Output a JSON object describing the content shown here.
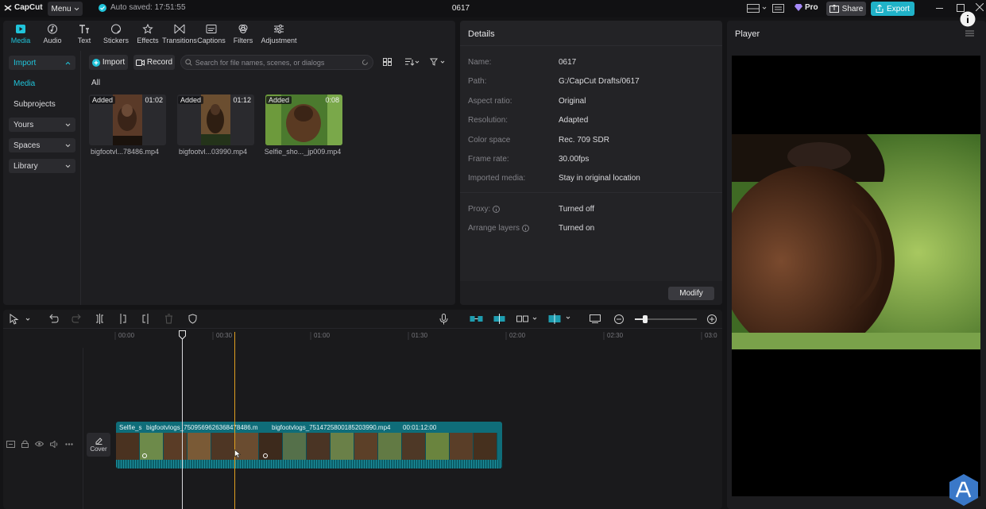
{
  "titlebar": {
    "app_name": "CapCut",
    "menu_label": "Menu",
    "autosave_text": "Auto saved: 17:51:55",
    "project_title": "0617",
    "pro_label": "Pro",
    "share_label": "Share",
    "export_label": "Export"
  },
  "tooltabs": [
    {
      "label": "Media",
      "icon": "media-icon",
      "active": true
    },
    {
      "label": "Audio",
      "icon": "audio-icon"
    },
    {
      "label": "Text",
      "icon": "text-icon"
    },
    {
      "label": "Stickers",
      "icon": "stickers-icon"
    },
    {
      "label": "Effects",
      "icon": "effects-icon"
    },
    {
      "label": "Transitions",
      "icon": "transitions-icon"
    },
    {
      "label": "Captions",
      "icon": "captions-icon"
    },
    {
      "label": "Filters",
      "icon": "filters-icon"
    },
    {
      "label": "Adjustment",
      "icon": "adjustment-icon"
    }
  ],
  "leftnav": {
    "import": "Import",
    "media": "Media",
    "subprojects": "Subprojects",
    "yours": "Yours",
    "spaces": "Spaces",
    "library": "Library"
  },
  "media": {
    "import_button": "Import",
    "record_button": "Record",
    "search_placeholder": "Search for file names, scenes, or dialogs",
    "filter_all": "All",
    "clips": [
      {
        "badge": "Added",
        "duration": "01:02",
        "name": "bigfootvl...78486.mp4"
      },
      {
        "badge": "Added",
        "duration": "01:12",
        "name": "bigfootvl...03990.mp4"
      },
      {
        "badge": "Added",
        "duration": "0:08",
        "name": "Selfie_sho..._jp009.mp4"
      }
    ]
  },
  "details": {
    "title": "Details",
    "rows": [
      {
        "key": "Name:",
        "value": "0617"
      },
      {
        "key": "Path:",
        "value": "G:/CapCut Drafts/0617"
      },
      {
        "key": "Aspect ratio:",
        "value": "Original"
      },
      {
        "key": "Resolution:",
        "value": "Adapted"
      },
      {
        "key": "Color space",
        "value": "Rec. 709 SDR"
      },
      {
        "key": "Frame rate:",
        "value": "30.00fps"
      },
      {
        "key": "Imported media:",
        "value": "Stay in original location"
      },
      {
        "key": "Proxy:",
        "value": "Turned off"
      },
      {
        "key": "Arrange layers",
        "value": "Turned on"
      }
    ],
    "modify_button": "Modify"
  },
  "player": {
    "title": "Player"
  },
  "timeline": {
    "ticks": [
      "00:00",
      "00:30",
      "01:00",
      "01:30",
      "02:00",
      "02:30",
      "03:0"
    ],
    "cover_label": "Cover",
    "segments": [
      {
        "label": "Selfie_s"
      },
      {
        "label": "bigfootvlogs_7509569626368478486.m"
      },
      {
        "label": "bigfootvlogs_7514725800185203990.mp4"
      },
      {
        "label": "00:01:12:00"
      }
    ]
  },
  "colors": {
    "accent": "#20c4da",
    "export_bg": "#20b2c8",
    "track": "#0f6d79",
    "cursor": "#e0a020"
  }
}
